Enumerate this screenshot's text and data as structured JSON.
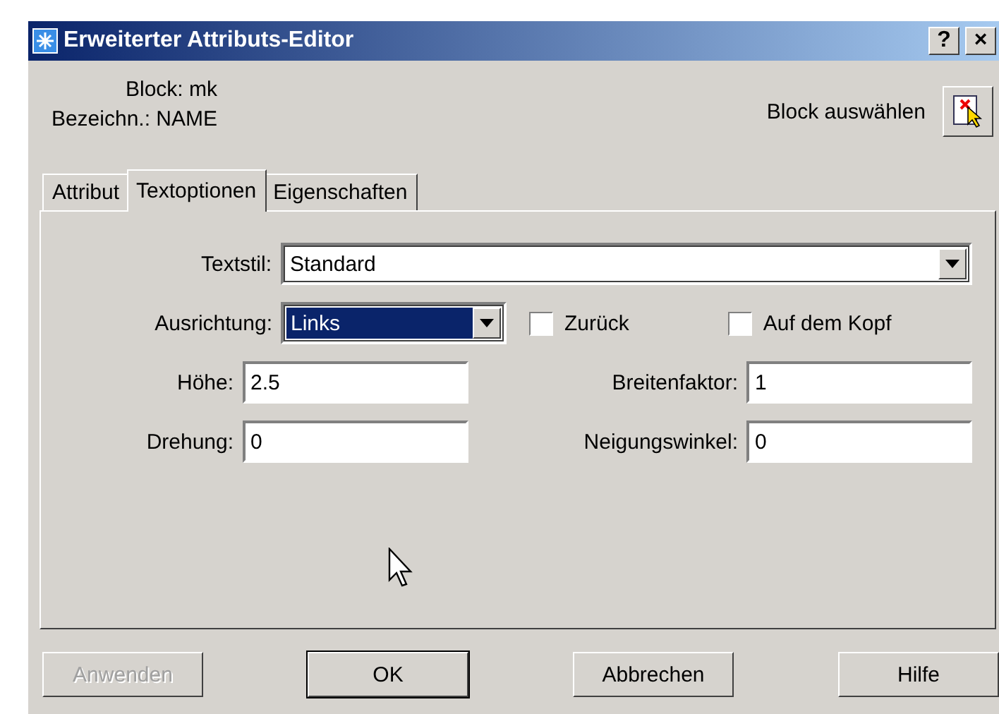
{
  "window": {
    "title": "Erweiterter Attributs-Editor",
    "help_button": "?",
    "close_button": "×"
  },
  "header": {
    "block_label": "Block: mk",
    "name_label": "Bezeichn.: NAME",
    "select_label": "Block auswählen"
  },
  "tabs": [
    {
      "label": "Attribut",
      "selected": false
    },
    {
      "label": "Textoptionen",
      "selected": true
    },
    {
      "label": "Eigenschaften",
      "selected": false
    }
  ],
  "text_style": {
    "label": "Textstil:",
    "value": "Standard"
  },
  "alignment": {
    "label": "Ausrichtung:",
    "value": "Links"
  },
  "checkboxes": [
    {
      "label": "Zurück",
      "checked": false
    },
    {
      "label": "Auf dem Kopf",
      "checked": false
    }
  ],
  "fields": [
    {
      "label": "Höhe:",
      "value": "2.5"
    },
    {
      "label": "Breitenfaktor:",
      "value": "1"
    },
    {
      "label": "Drehung:",
      "value": "0"
    },
    {
      "label": "Neigungswinkel:",
      "value": "0"
    }
  ],
  "buttons": [
    {
      "label": "Anwenden",
      "disabled": true,
      "default": false
    },
    {
      "label": "OK",
      "disabled": false,
      "default": true
    },
    {
      "label": "Abbrechen",
      "disabled": false,
      "default": false
    },
    {
      "label": "Hilfe",
      "disabled": false,
      "default": false
    }
  ]
}
